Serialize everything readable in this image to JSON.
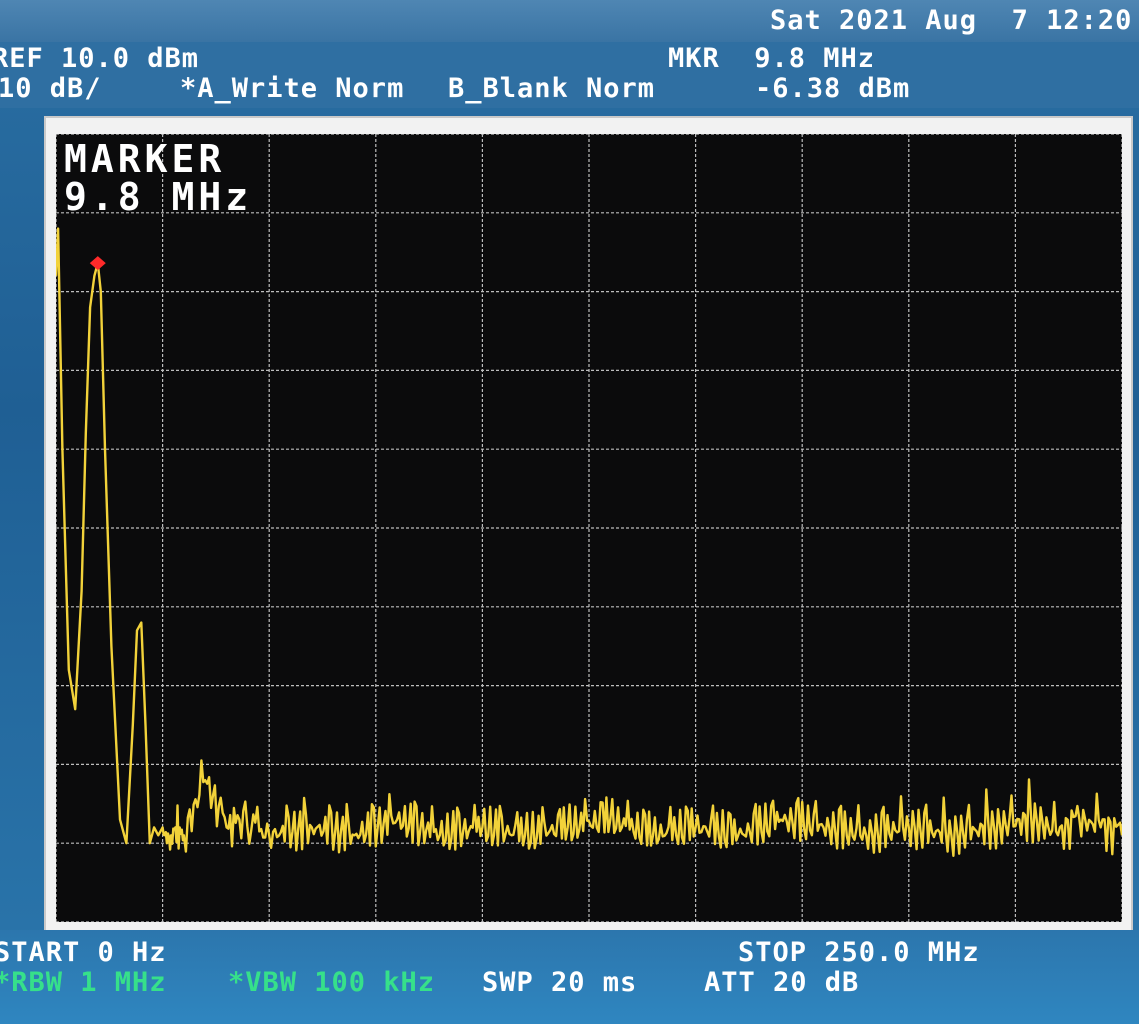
{
  "status": {
    "datetime": "Sat 2021 Aug  7 12:20"
  },
  "header": {
    "ref_level": "REF 10.0 dBm",
    "scale": "10 dB/",
    "trace_a": "*A_Write Norm",
    "trace_b": "B_Blank Norm",
    "marker_freq": "MKR  9.8 MHz",
    "marker_level": "-6.38 dBm"
  },
  "marker_box": {
    "title": "MARKER",
    "value": "9.8 MHz"
  },
  "footer": {
    "start": "START 0 Hz",
    "stop": "STOP 250.0 MHz",
    "rbw": "*RBW 1 MHz",
    "vbw": "*VBW 100 kHz",
    "sweep": "SWP 20 ms",
    "attenuation": "ATT 20 dB"
  },
  "colors": {
    "trace": "#f2d23a",
    "marker": "#ff2a2a",
    "grid": "#bdbdbd",
    "readout_green": "#36e08a"
  },
  "chart_data": {
    "type": "line",
    "x_unit": "MHz",
    "y_unit": "dBm",
    "xlim": [
      0,
      250
    ],
    "ylim": [
      -90,
      10
    ],
    "grid": true,
    "series": [
      {
        "x": [
          0,
          0.5,
          1.5,
          3,
          4.5,
          6,
          7,
          8,
          9,
          9.8,
          10.5,
          11.5,
          13,
          15,
          16.5,
          18,
          19,
          20,
          21,
          22,
          23,
          24,
          25,
          26,
          27,
          28,
          29,
          30,
          35,
          40,
          43,
          50,
          60,
          70,
          80,
          90,
          100,
          110,
          120,
          130,
          140,
          150,
          160,
          170,
          180,
          190,
          200,
          210,
          220,
          230,
          235,
          240,
          245,
          250
        ],
        "values": [
          -8,
          -2,
          -30,
          -58,
          -63,
          -48,
          -28,
          -12,
          -8,
          -6.4,
          -10,
          -30,
          -55,
          -77,
          -80,
          -65,
          -53,
          -52,
          -65,
          -80,
          -78,
          -79,
          -78,
          -80,
          -79,
          -78,
          -78,
          -79,
          -72,
          -78,
          -77,
          -79,
          -78,
          -79,
          -77,
          -79,
          -78,
          -79,
          -78,
          -77,
          -79,
          -78,
          -79,
          -77,
          -78,
          -79,
          -78,
          -79,
          -78,
          -77,
          -79,
          -77,
          -78,
          -79
        ]
      }
    ],
    "marker": {
      "x": 9.8,
      "y": -6.38
    }
  }
}
